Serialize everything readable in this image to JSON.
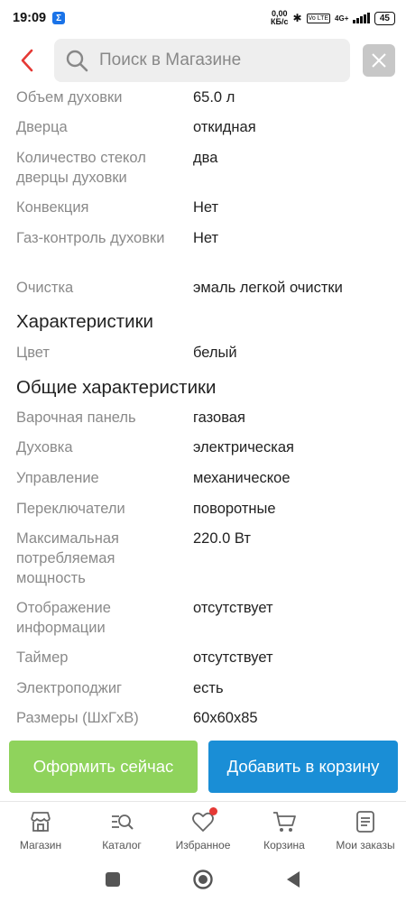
{
  "status_bar": {
    "time": "19:09",
    "net_speed_top": "0,00",
    "net_speed_bottom": "КБ/с",
    "network_label": "4G+",
    "volte_label": "Vo LTE",
    "battery": "45"
  },
  "header": {
    "search_placeholder": "Поиск в Магазине",
    "back_icon": "chevron-left-icon",
    "search_icon": "search-icon",
    "clear_icon": "close-icon"
  },
  "specs_top": [
    {
      "label": "Объем духовки",
      "value": "65.0 л"
    },
    {
      "label": "Дверца",
      "value": "откидная"
    },
    {
      "label": "Количество стекол дверцы духовки",
      "value": "два"
    },
    {
      "label": "Конвекция",
      "value": "Нет"
    },
    {
      "label": "Газ-контроль духовки",
      "value": "Нет"
    },
    {
      "label": "Очистка",
      "value": "эмаль легкой очистки"
    }
  ],
  "section_characteristics": {
    "title": "Характеристики",
    "rows": [
      {
        "label": "Цвет",
        "value": "белый"
      }
    ]
  },
  "section_general": {
    "title": "Общие характеристики",
    "rows": [
      {
        "label": "Варочная панель",
        "value": "газовая"
      },
      {
        "label": "Духовка",
        "value": "электрическая"
      },
      {
        "label": "Управление",
        "value": "механическое"
      },
      {
        "label": "Переключатели",
        "value": "поворотные"
      },
      {
        "label": "Максимальная потребляемая мощность",
        "value": "220.0 Вт"
      },
      {
        "label": "Отображение информации",
        "value": "отсутствует"
      },
      {
        "label": "Таймер",
        "value": "отсутствует"
      },
      {
        "label": "Электроподжиг",
        "value": "есть"
      },
      {
        "label": "Размеры (ШхГхВ)",
        "value": "60х60х85"
      }
    ]
  },
  "actions": {
    "checkout_label": "Оформить сейчас",
    "add_to_cart_label": "Добавить в корзину",
    "checkout_color": "#8fd35c",
    "cart_color": "#1a8ed6"
  },
  "bottom_nav": [
    {
      "label": "Магазин",
      "icon": "store-icon"
    },
    {
      "label": "Каталог",
      "icon": "catalog-search-icon"
    },
    {
      "label": "Избранное",
      "icon": "heart-icon"
    },
    {
      "label": "Корзина",
      "icon": "cart-icon"
    },
    {
      "label": "Мои заказы",
      "icon": "orders-icon"
    }
  ]
}
